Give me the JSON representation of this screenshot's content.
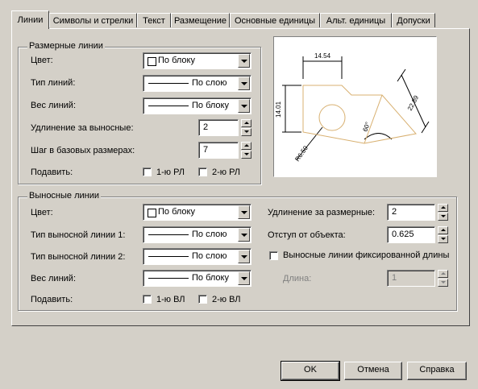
{
  "tabs": [
    "Линии",
    "Символы и стрелки",
    "Текст",
    "Размещение",
    "Основные единицы",
    "Альт. единицы",
    "Допуски"
  ],
  "dim_lines": {
    "title": "Размерные линии",
    "color_label": "Цвет:",
    "color_value": "По блоку",
    "linetype_label": "Тип линий:",
    "linetype_value": "По слою",
    "lineweight_label": "Вес линий:",
    "lineweight_value": "По блоку",
    "extend_label": "Удлинение за выносные:",
    "extend_value": "2",
    "baseline_label": "Шаг в базовых размерах:",
    "baseline_value": "7",
    "suppress_label": "Подавить:",
    "suppress_1": "1-ю РЛ",
    "suppress_2": "2-ю РЛ"
  },
  "ext_lines": {
    "title": "Выносные линии",
    "color_label": "Цвет:",
    "color_value": "По блоку",
    "linetype1_label": "Тип выносной линии 1:",
    "linetype1_value": "По слою",
    "linetype2_label": "Тип выносной линии 2:",
    "linetype2_value": "По слою",
    "lineweight_label": "Вес линий:",
    "lineweight_value": "По блоку",
    "suppress_label": "Подавить:",
    "suppress_1": "1-ю ВЛ",
    "suppress_2": "2-ю ВЛ",
    "extend_label": "Удлинение за размерные:",
    "extend_value": "2",
    "offset_label": "Отступ от объекта:",
    "offset_value": "0.625",
    "fixed_label": "Выносные линии фиксированной длины",
    "length_label": "Длина:",
    "length_value": "1"
  },
  "preview": {
    "dim_top": "14.54",
    "dim_left": "14.01",
    "dim_right": "22.89",
    "dim_angle": "60°",
    "dim_radius": "R6.50"
  },
  "buttons": {
    "ok": "OK",
    "cancel": "Отмена",
    "help": "Справка"
  }
}
